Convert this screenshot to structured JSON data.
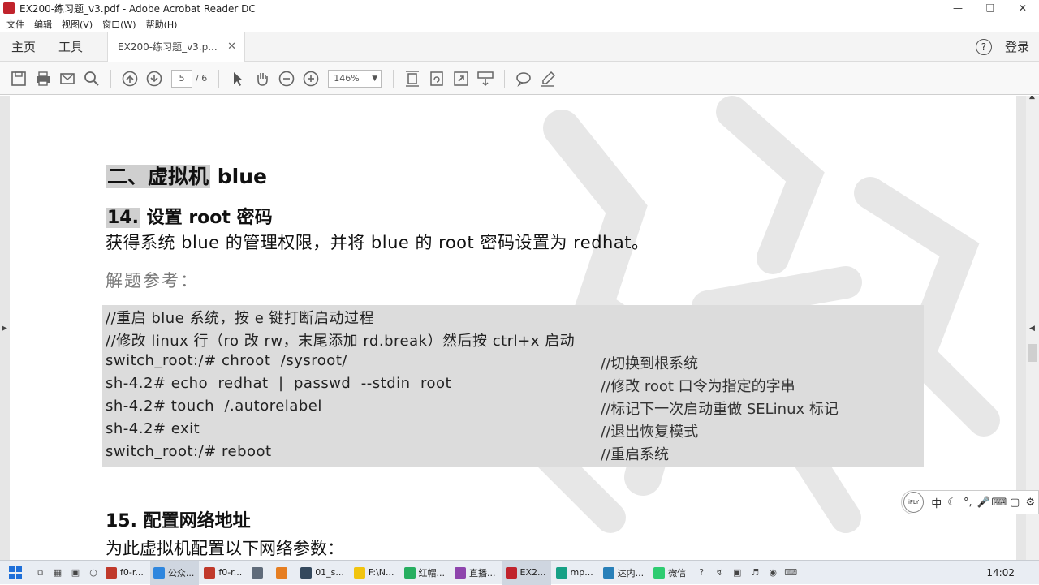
{
  "window": {
    "title": "EX200-练习题_v3.pdf - Adobe Acrobat Reader DC"
  },
  "menu": [
    "文件",
    "编辑",
    "视图(V)",
    "窗口(W)",
    "帮助(H)"
  ],
  "tabs": {
    "home": "主页",
    "tools": "工具",
    "document": "EX200-练习题_v3.p...",
    "login": "登录"
  },
  "toolbar": {
    "page_current": "5",
    "page_total": "/ 6",
    "zoom": "146%"
  },
  "document": {
    "section_num": "二、虚拟机",
    "section_name": "blue",
    "q14_num": "14.",
    "q14_title": "设置 root 密码",
    "q14_desc": "获得系统 blue 的管理权限，并将 blue 的 root 密码设置为 redhat。",
    "reference": "解题参考：",
    "code": [
      {
        "cmd": "//重启 blue 系统，按 e 键打断启动过程",
        "comment": ""
      },
      {
        "cmd": "//修改 linux 行（ro 改 rw，末尾添加 rd.break）然后按 ctrl+x 启动",
        "comment": ""
      },
      {
        "cmd": "switch_root:/# chroot  /sysroot/",
        "comment": "//切换到根系统"
      },
      {
        "cmd": "sh-4.2# echo  redhat  |  passwd  --stdin  root",
        "comment": "//修改 root 口令为指定的字串"
      },
      {
        "cmd": "sh-4.2# touch  /.autorelabel",
        "comment": "//标记下一次启动重做 SELinux 标记"
      },
      {
        "cmd": "sh-4.2# exit",
        "comment": "//退出恢复模式"
      },
      {
        "cmd": "switch_root:/# reboot",
        "comment": "//重启系统"
      }
    ],
    "q15_title": "15.  配置网络地址",
    "q15_desc": "为此虚拟机配置以下网络参数："
  },
  "ime": {
    "logo": "iFLY",
    "lang": "中"
  },
  "taskbar": {
    "items": [
      {
        "label": "f0-r...",
        "color": "#c0392b"
      },
      {
        "label": "公众...",
        "color": "#2e86de"
      },
      {
        "label": "f0-r...",
        "color": "#c0392b"
      },
      {
        "label": "",
        "color": "#5f6b7a"
      },
      {
        "label": "",
        "color": "#e67e22"
      },
      {
        "label": "01_s...",
        "color": "#34495e"
      },
      {
        "label": "F:\\N...",
        "color": "#f1c40f"
      },
      {
        "label": "红帽...",
        "color": "#27ae60"
      },
      {
        "label": "直播...",
        "color": "#8e44ad"
      },
      {
        "label": "EX2...",
        "color": "#c0232c"
      },
      {
        "label": "mp...",
        "color": "#16a085"
      },
      {
        "label": "达内...",
        "color": "#2980b9"
      },
      {
        "label": "微信",
        "color": "#2ecc71"
      }
    ],
    "clock": "14:02"
  },
  "colors": {
    "code_bg": "#dcdcdc",
    "highlight": "#cfcfcf",
    "toolbar_bg": "#f8f8f8",
    "doc_bg": "#e6e6e6"
  }
}
